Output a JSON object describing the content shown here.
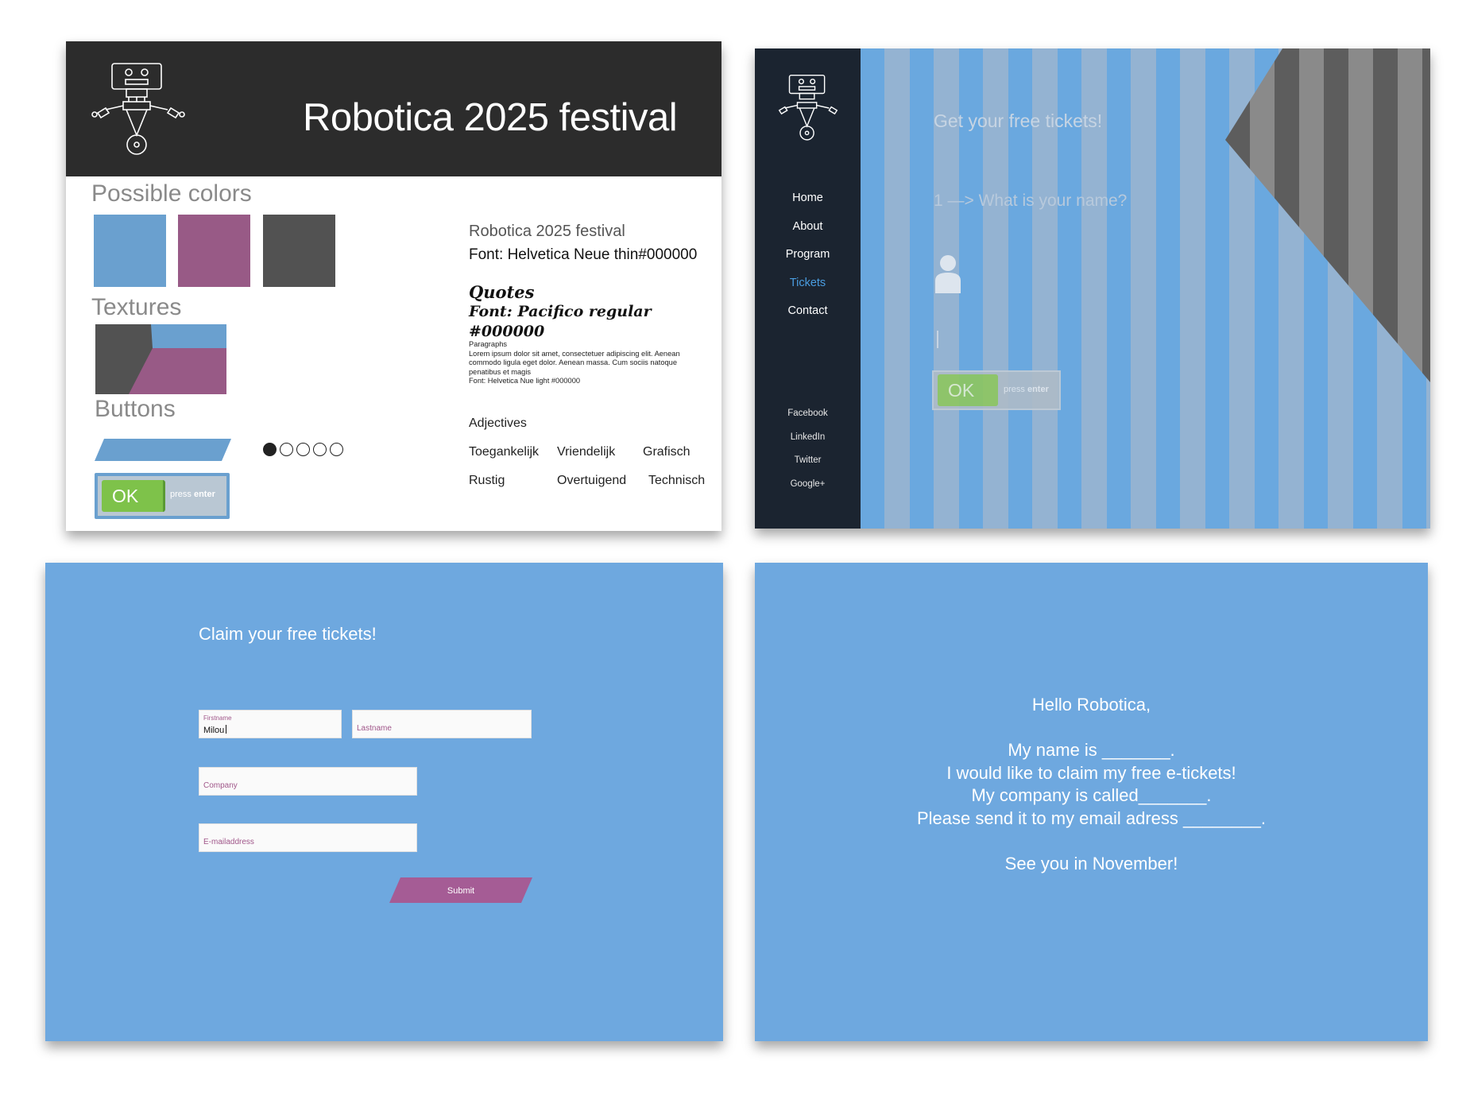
{
  "colors": {
    "blue": "#6aa0cf",
    "purple": "#985a86",
    "dark": "#525252",
    "green": "#7ec24a",
    "light_blue": "#6ea8df"
  },
  "style_guide": {
    "title": "Robotica 2025 festival",
    "possible_colors_label": "Possible colors",
    "textures_label": "Textures",
    "buttons_label": "Buttons",
    "ok_label": "OK",
    "press_label": "press",
    "enter_label": "enter",
    "typography_title": "Robotica 2025 festival",
    "typography_font": "Font: Helvetica Neue thin#000000",
    "quotes_label": "Quotes",
    "quotes_font": "Font: Pacifico regular #000000",
    "paragraphs": [
      "Paragraphs",
      "Lorem ipsum dolor sit amet, consectetuer adipiscing elit. Aenean commodo ligula eget dolor. Aenean massa. Cum sociis natoque penatibus et magis",
      "Font: Helvetica Nue light #000000"
    ],
    "adjectives_title": "Adjectives",
    "adjectives": [
      "Toegankelijk",
      "Vriendelijk",
      "Grafisch",
      "Rustig",
      "Overtuigend",
      "Technisch"
    ],
    "pagination_active_index": 0,
    "pagination_count": 5
  },
  "ticket_screen": {
    "nav": [
      "Home",
      "About",
      "Program",
      "Tickets",
      "Contact"
    ],
    "active_nav": "Tickets",
    "social": [
      "Facebook",
      "LinkedIn",
      "Twitter",
      "Google+"
    ],
    "heading": "Get your free tickets!",
    "question": "1 —> What is your name?",
    "ok_label": "OK",
    "press_label": "press",
    "enter_label": "enter"
  },
  "form_screen": {
    "heading": "Claim your free tickets!",
    "firstname_label": "Firstname",
    "firstname_value": "Milou",
    "lastname_placeholder": "Lastname",
    "company_placeholder": "Company",
    "email_placeholder": "E-mailaddress",
    "submit_label": "Submit"
  },
  "letter_screen": {
    "lines": [
      "Hello Robotica,",
      "",
      "My name is _______.",
      "I would like to claim my free e-tickets!",
      "My company is called_______.",
      "Please send it to my email adress ________.",
      "",
      "See you in November!"
    ]
  }
}
